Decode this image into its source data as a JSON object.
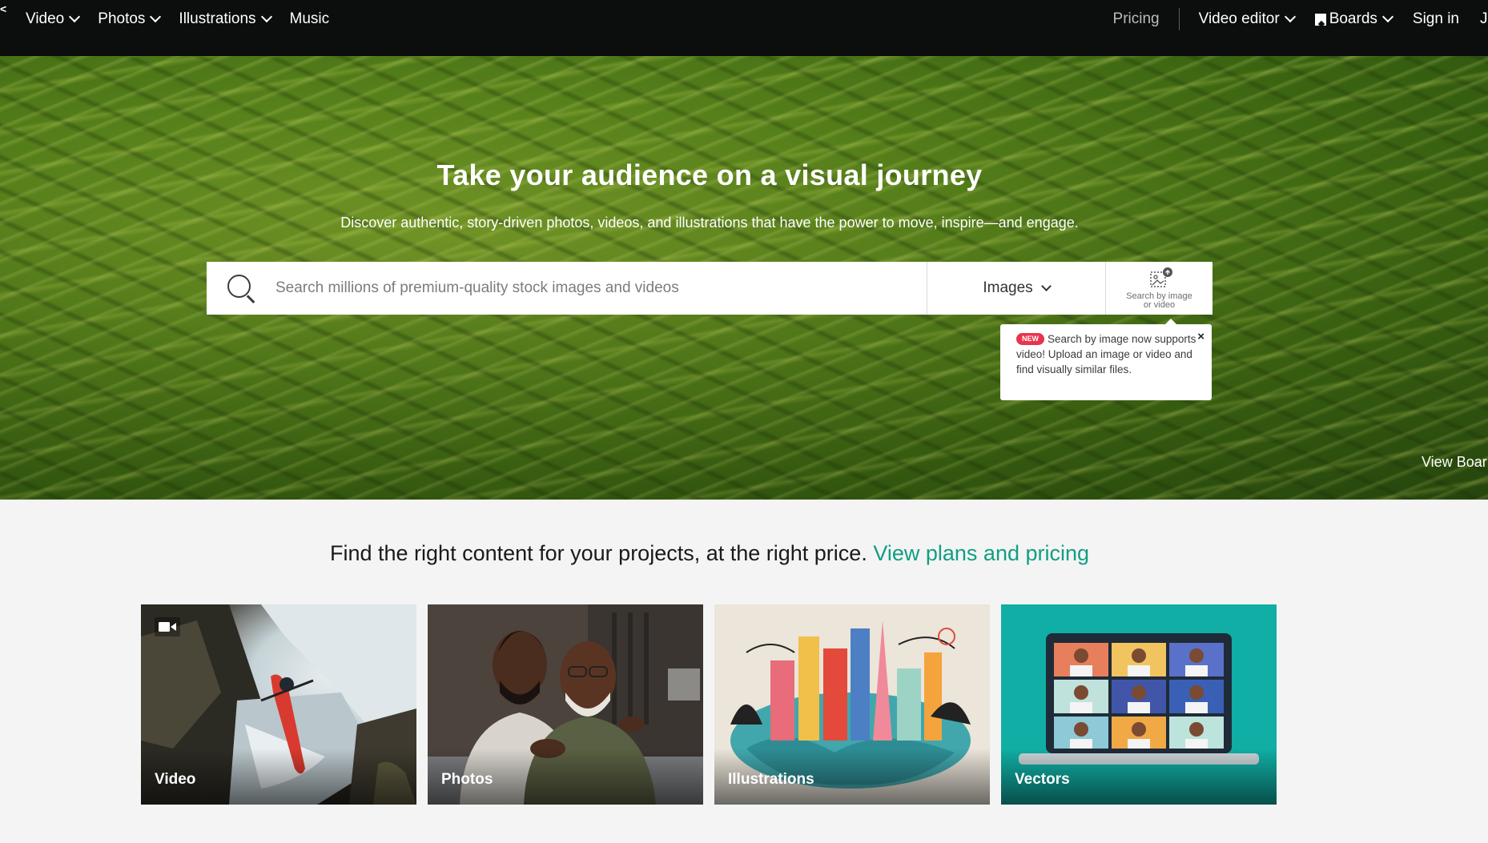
{
  "topnav": {
    "logo_fragment": "<",
    "left_items": [
      {
        "label": "Video",
        "has_dropdown": true
      },
      {
        "label": "Photos",
        "has_dropdown": true
      },
      {
        "label": "Illustrations",
        "has_dropdown": true
      },
      {
        "label": "Music",
        "has_dropdown": false
      }
    ],
    "pricing": "Pricing",
    "video_editor": "Video editor",
    "boards": "Boards",
    "sign_in": "Sign in",
    "cut_item": "J"
  },
  "hero": {
    "title": "Take your audience on a visual journey",
    "subtitle": "Discover authentic, story-driven photos, videos, and illustrations that have the power to move, inspire—and engage.",
    "search": {
      "placeholder": "Search millions of premium-quality stock images and videos",
      "value": "",
      "type_selected": "Images",
      "search_by_image_line1": "Search by image",
      "search_by_image_line2": "or video"
    },
    "tooltip": {
      "badge": "NEW",
      "text": "Search by image now supports video! Upload an image or video and find visually similar files.",
      "close": "×"
    },
    "view_board": "View Boar"
  },
  "pitch": {
    "text": "Find the right content for your projects, at the right price.",
    "link": "View plans and pricing"
  },
  "tiles": [
    {
      "label": "Video",
      "icon": "video-camera-icon"
    },
    {
      "label": "Photos"
    },
    {
      "label": "Illustrations"
    },
    {
      "label": "Vectors"
    }
  ],
  "colors": {
    "nav_bg": "#0c0d0d",
    "link_green": "#129e83",
    "new_badge": "#e8344c",
    "vectors_teal": "#10aea4"
  }
}
